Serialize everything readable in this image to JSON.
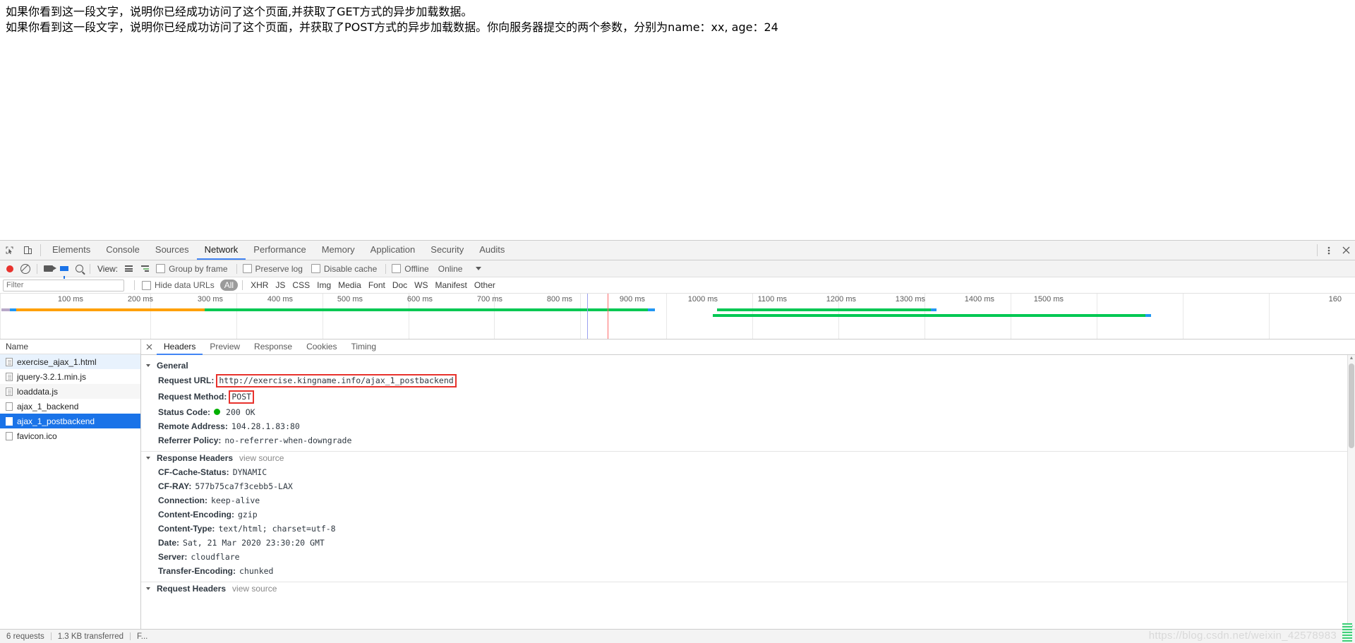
{
  "page": {
    "lines": [
      "如果你看到这一段文字，说明你已经成功访问了这个页面,并获取了GET方式的异步加载数据。",
      "如果你看到这一段文字，说明你已经成功访问了这个页面，并获取了POST方式的异步加载数据。你向服务器提交的两个参数，分别为name：xx, age：24"
    ]
  },
  "devtools": {
    "tabs": [
      {
        "label": "Elements",
        "active": false
      },
      {
        "label": "Console",
        "active": false
      },
      {
        "label": "Sources",
        "active": false
      },
      {
        "label": "Network",
        "active": true
      },
      {
        "label": "Performance",
        "active": false
      },
      {
        "label": "Memory",
        "active": false
      },
      {
        "label": "Application",
        "active": false
      },
      {
        "label": "Security",
        "active": false
      },
      {
        "label": "Audits",
        "active": false
      }
    ],
    "toolbar": {
      "view_label": "View:",
      "group_by_frame": "Group by frame",
      "preserve_log": "Preserve log",
      "disable_cache": "Disable cache",
      "offline": "Offline",
      "throttling": "Online"
    },
    "filterbar": {
      "filter_placeholder": "Filter",
      "hide_data_urls": "Hide data URLs",
      "types": [
        "All",
        "XHR",
        "JS",
        "CSS",
        "Img",
        "Media",
        "Font",
        "Doc",
        "WS",
        "Manifest",
        "Other"
      ],
      "active_type": "All"
    },
    "timeline": {
      "ticks": [
        "100 ms",
        "200 ms",
        "300 ms",
        "400 ms",
        "500 ms",
        "600 ms",
        "700 ms",
        "800 ms",
        "900 ms",
        "1000 ms",
        "1100 ms",
        "1200 ms",
        "1300 ms",
        "1400 ms",
        "1500 ms",
        "160"
      ]
    },
    "requests": {
      "column_header": "Name",
      "items": [
        {
          "name": "exercise_ajax_1.html",
          "icon": "document-icon",
          "state": "first"
        },
        {
          "name": "jquery-3.2.1.min.js",
          "icon": "document-icon",
          "state": "normal"
        },
        {
          "name": "loaddata.js",
          "icon": "document-icon",
          "state": "alt"
        },
        {
          "name": "ajax_1_backend",
          "icon": "blank-document-icon",
          "state": "normal"
        },
        {
          "name": "ajax_1_postbackend",
          "icon": "blank-document-icon",
          "state": "selected"
        },
        {
          "name": "favicon.ico",
          "icon": "blank-document-icon",
          "state": "normal"
        }
      ]
    },
    "detail": {
      "tabs": [
        {
          "label": "Headers",
          "active": true
        },
        {
          "label": "Preview",
          "active": false
        },
        {
          "label": "Response",
          "active": false
        },
        {
          "label": "Cookies",
          "active": false
        },
        {
          "label": "Timing",
          "active": false
        }
      ],
      "general": {
        "title": "General",
        "rows": [
          {
            "key": "Request URL:",
            "value": "http://exercise.kingname.info/ajax_1_postbackend",
            "boxed": true
          },
          {
            "key": "Request Method:",
            "value": "POST",
            "boxed": true
          },
          {
            "key": "Status Code:",
            "value": "200 OK",
            "dot": true
          },
          {
            "key": "Remote Address:",
            "value": "104.28.1.83:80"
          },
          {
            "key": "Referrer Policy:",
            "value": "no-referrer-when-downgrade"
          }
        ]
      },
      "response_headers": {
        "title": "Response Headers",
        "view_source": "view source",
        "rows": [
          {
            "key": "CF-Cache-Status:",
            "value": "DYNAMIC"
          },
          {
            "key": "CF-RAY:",
            "value": "577b75ca7f3cebb5-LAX"
          },
          {
            "key": "Connection:",
            "value": "keep-alive"
          },
          {
            "key": "Content-Encoding:",
            "value": "gzip"
          },
          {
            "key": "Content-Type:",
            "value": "text/html; charset=utf-8"
          },
          {
            "key": "Date:",
            "value": "Sat, 21 Mar 2020 23:30:20 GMT"
          },
          {
            "key": "Server:",
            "value": "cloudflare"
          },
          {
            "key": "Transfer-Encoding:",
            "value": "chunked"
          }
        ]
      },
      "request_headers": {
        "title": "Request Headers",
        "view_source": "view source"
      }
    },
    "status": {
      "requests": "6 requests",
      "transferred": "1.3 KB transferred",
      "finish": "F..."
    },
    "watermark": "https://blog.csdn.net/weixin_42578983"
  },
  "colors": {
    "accent": "#4285f4",
    "selection": "#1a73e8",
    "record": "#e8322d",
    "status_ok": "#00b000",
    "bar_green": "#00c853",
    "bar_orange": "#ffa000",
    "bar_blue": "#2196f3",
    "highlight_box": "#e8322d"
  }
}
